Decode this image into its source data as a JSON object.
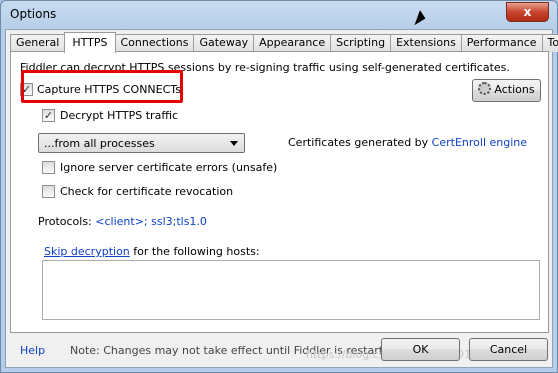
{
  "window": {
    "title": "Options",
    "close_glyph": "x"
  },
  "tabs": [
    {
      "label": "General"
    },
    {
      "label": "HTTPS"
    },
    {
      "label": "Connections"
    },
    {
      "label": "Gateway"
    },
    {
      "label": "Appearance"
    },
    {
      "label": "Scripting"
    },
    {
      "label": "Extensions"
    },
    {
      "label": "Performance"
    },
    {
      "label": "Tools"
    }
  ],
  "active_tab": "HTTPS",
  "https": {
    "description": "Fiddler can decrypt HTTPS sessions by re-signing traffic using self-generated certificates.",
    "capture_label": "Capture HTTPS CONNECTs",
    "capture_checked": true,
    "decrypt_label": "Decrypt HTTPS traffic",
    "decrypt_checked": true,
    "actions_label": "Actions",
    "process_select": "...from all processes",
    "certs_prefix": "Certificates generated by ",
    "certs_link": "CertEnroll engine",
    "ignore_errors_label": "Ignore server certificate errors (unsafe)",
    "ignore_errors_checked": false,
    "revocation_label": "Check for certificate revocation",
    "revocation_checked": false,
    "protocols_label": "Protocols: ",
    "protocols_value": "<client>; ssl3;tls1.0",
    "skip_link": "Skip decryption",
    "skip_suffix": " for the following hosts:",
    "skip_hosts_value": ""
  },
  "footer": {
    "help": "Help",
    "note": "Note: Changes may not take effect until Fiddler is restarted.",
    "watermark": "https://blog.csdn.net/u_3219188",
    "ok": "OK",
    "cancel": "Cancel"
  },
  "colors": {
    "link": "#0d41c8",
    "highlight": "#e60000"
  },
  "icons": {
    "checkmark": "✓",
    "actions": "gear-icon"
  }
}
